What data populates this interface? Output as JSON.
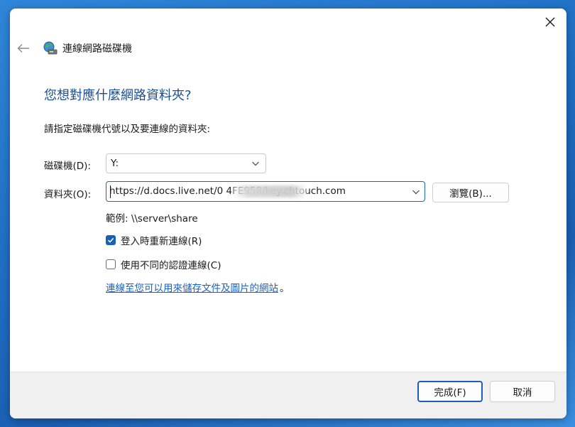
{
  "window": {
    "title": "連線網路磁碟機",
    "close_icon": "close-icon",
    "back_icon": "back-arrow-icon",
    "title_icon": "network-drive-icon"
  },
  "main": {
    "heading": "您想對應什麼網路資料夾?",
    "instruction": "請指定磁碟機代號以及要連線的資料夾:",
    "drive_label": "磁碟機(D):",
    "drive_value": "Y:",
    "folder_label": "資料夾(O):",
    "folder_value": "https://d.docs.live.net/0                    4FE958/key.chtouch.com",
    "browse_label": "瀏覽(B)...",
    "example": "範例: \\\\server\\share",
    "reconnect_label": "登入時重新連線(R)",
    "reconnect_checked": true,
    "diff_creds_label": "使用不同的認證連線(C)",
    "diff_creds_checked": false,
    "link_text": "連線至您可以用來儲存文件及圖片的網站",
    "link_suffix": "。"
  },
  "footer": {
    "finish_label": "完成(F)",
    "cancel_label": "取消"
  },
  "colors": {
    "accent": "#1a5fb8",
    "heading": "#1c4f91",
    "link": "#1a62c0",
    "desktop": "#1f6fc4"
  }
}
